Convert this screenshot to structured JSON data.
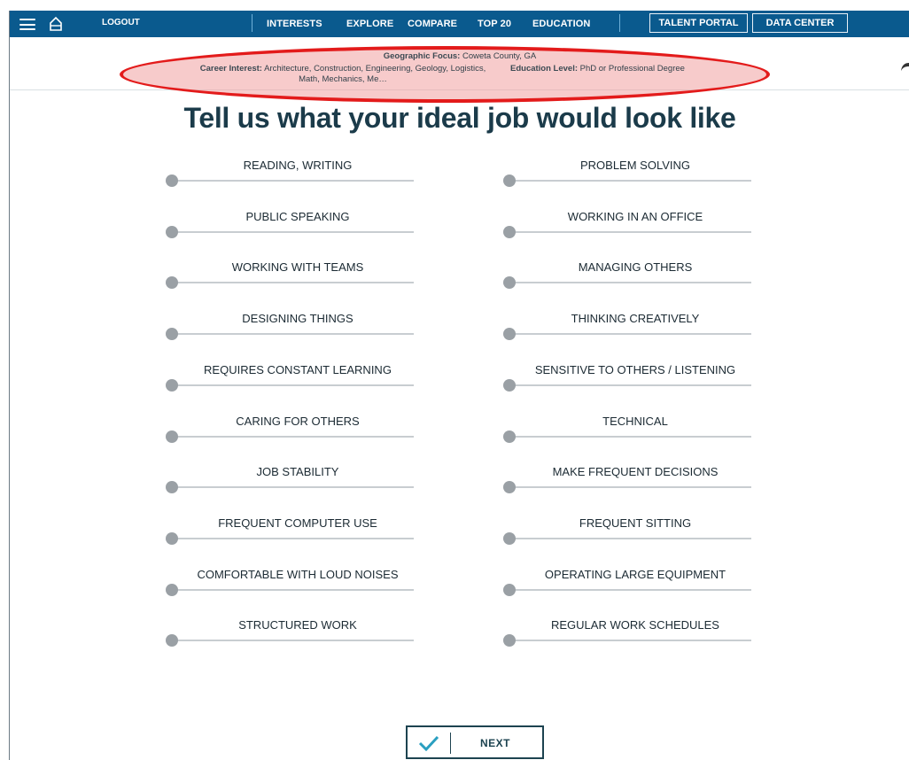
{
  "nav": {
    "logout": "LOGOUT",
    "links": [
      "INTERESTS",
      "EXPLORE",
      "COMPARE",
      "TOP 20",
      "EDUCATION"
    ],
    "talent_portal": "TALENT PORTAL",
    "data_center": "DATA CENTER"
  },
  "filters": {
    "geo_label": "Geographic Focus:",
    "geo_value": "Coweta County, GA",
    "career_label": "Career Interest:",
    "career_value": "Architecture, Construction, Engineering, Geology, Logistics, Math, Mechanics, Me…",
    "edu_label": "Education Level:",
    "edu_value": "PhD or Professional Degree"
  },
  "heading": "Tell us what your ideal job would look like",
  "sliders": {
    "left": [
      "READING, WRITING",
      "PUBLIC SPEAKING",
      "WORKING WITH TEAMS",
      "DESIGNING THINGS",
      "REQUIRES CONSTANT LEARNING",
      "CARING FOR OTHERS",
      "JOB STABILITY",
      "FREQUENT COMPUTER USE",
      "COMFORTABLE WITH LOUD NOISES",
      "STRUCTURED WORK"
    ],
    "right": [
      "PROBLEM SOLVING",
      "WORKING IN AN OFFICE",
      "MANAGING OTHERS",
      "THINKING CREATIVELY",
      "SENSITIVE TO OTHERS / LISTENING",
      "TECHNICAL",
      "MAKE FREQUENT DECISIONS",
      "FREQUENT SITTING",
      "OPERATING LARGE EQUIPMENT",
      "REGULAR WORK SCHEDULES"
    ],
    "value": 0
  },
  "next_label": "NEXT",
  "colors": {
    "nav_bg": "#0a5a8e",
    "heading": "#1b3b4a",
    "highlight": "#e31b1b",
    "knob": "#9aa0a5"
  }
}
